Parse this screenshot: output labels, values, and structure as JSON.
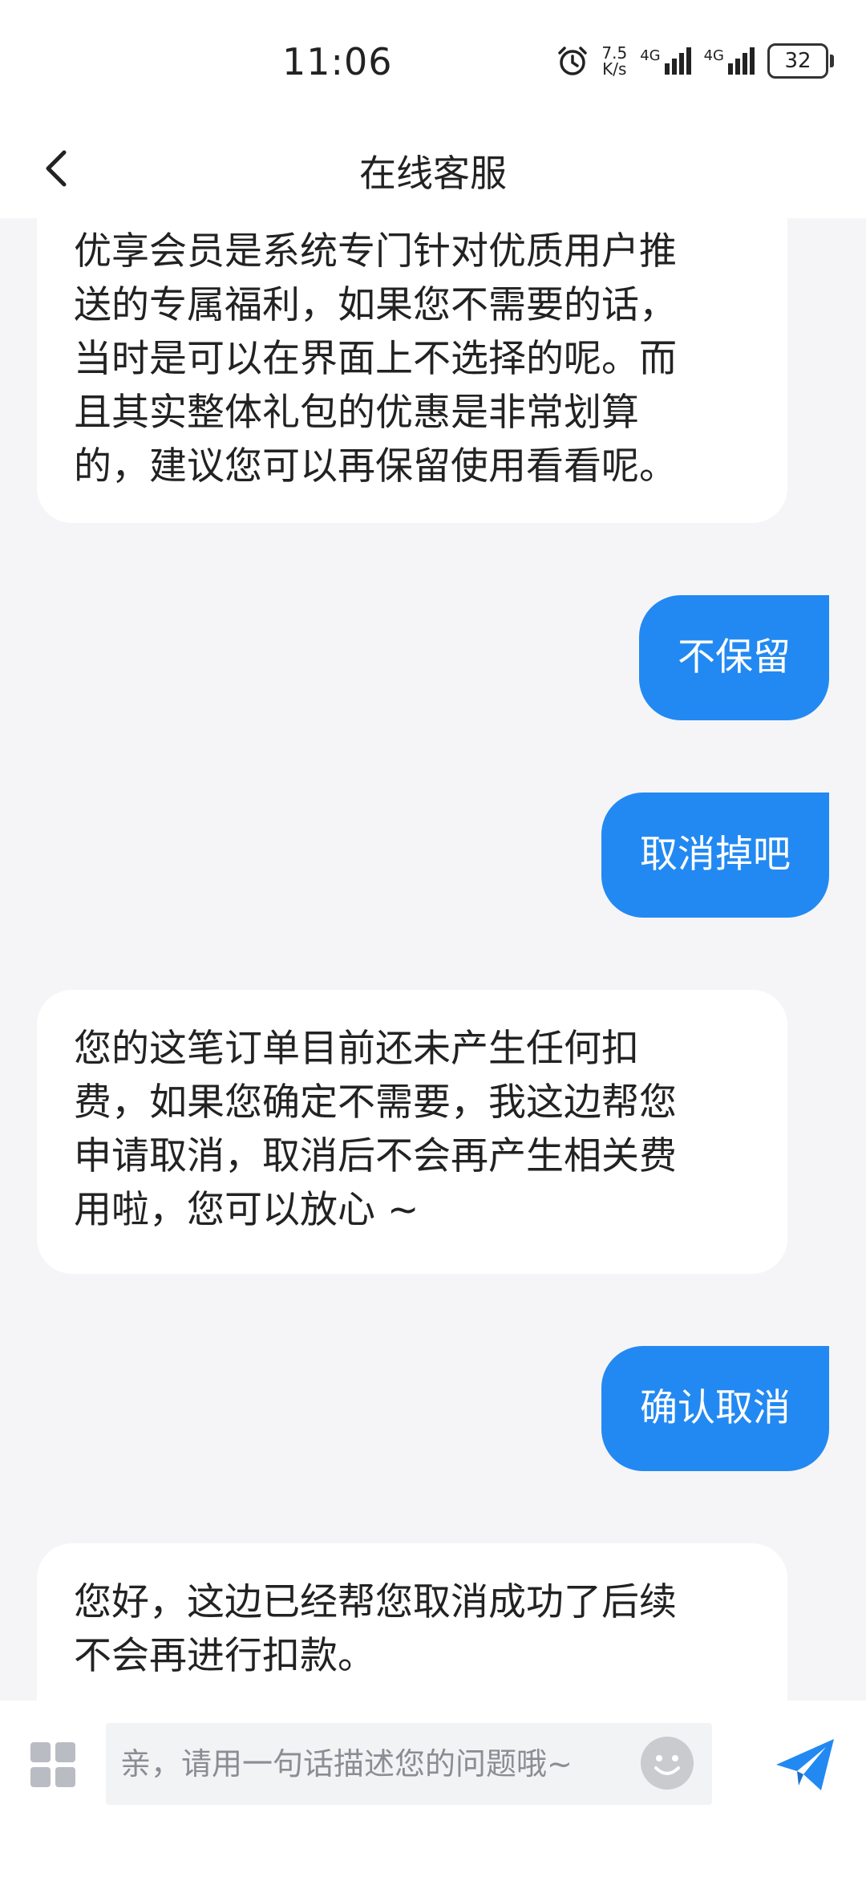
{
  "status_bar": {
    "time": "11:06",
    "net_speed_value": "7.5",
    "net_speed_unit": "K/s",
    "sim1_label": "4G",
    "sim2_label": "4G",
    "battery_level": "32",
    "icons": [
      "alarm-icon",
      "signal-icon",
      "battery-icon"
    ]
  },
  "header": {
    "back_icon": "chevron-left-icon",
    "title": "在线客服"
  },
  "messages": [
    {
      "sender": "agent",
      "lines": [
        "优享会员是系统专门针对优质用户推",
        "送的专属福利，如果您不需要的话，",
        "当时是可以在界面上不选择的呢。而",
        "且其实整体礼包的优惠是非常划算",
        "的，建议您可以再保留使用看看呢。"
      ]
    },
    {
      "sender": "user",
      "text": "不保留"
    },
    {
      "sender": "user",
      "text": "取消掉吧"
    },
    {
      "sender": "agent",
      "lines": [
        "您的这笔订单目前还未产生任何扣",
        "费，如果您确定不需要，我这边帮您",
        "申请取消，取消后不会再产生相关费",
        "用啦，您可以放心 ~"
      ]
    },
    {
      "sender": "user",
      "text": "确认取消"
    },
    {
      "sender": "agent",
      "lines": [
        "您好，这边已经帮您取消成功了后续",
        "不会再进行扣款。"
      ]
    }
  ],
  "input_bar": {
    "more_icon": "grid-icon",
    "placeholder": "亲，请用一句话描述您的问题哦~",
    "value": "",
    "emoji_icon": "emoji-icon",
    "send_icon": "send-icon"
  },
  "colors": {
    "user_bubble": "#2389f2",
    "agent_bubble": "#ffffff",
    "background": "#f5f5f7"
  }
}
